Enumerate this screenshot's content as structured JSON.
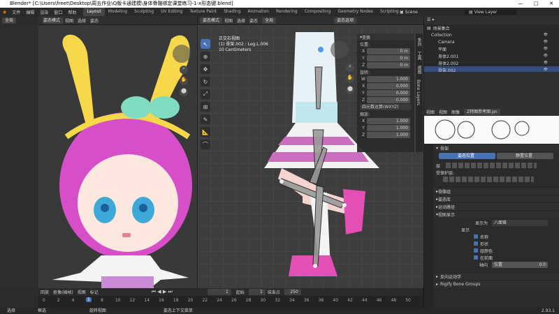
{
  "window": {
    "title": "Blender* [C:\\Users\\freet\\Desktop\\周五作业\\Q版卡通建模\\身体骨骼绑定课堂练习-1-x形态键.blend]",
    "controls": [
      "—",
      "□",
      "✕"
    ]
  },
  "menu": [
    "文件",
    "编辑",
    "渲染",
    "窗口",
    "帮助"
  ],
  "workspaces": [
    "Layout",
    "Modeling",
    "Sculpting",
    "UV Editing",
    "Texture Paint",
    "Shading",
    "Animation",
    "Rendering",
    "Compositing",
    "Geometry Nodes",
    "Scripting"
  ],
  "active_workspace": "Layout",
  "scene": {
    "label": "Scene",
    "view_layer": "View Layer"
  },
  "left_view": {
    "mode": "姿态模式",
    "menus": [
      "视图",
      "选择",
      "姿态"
    ],
    "orient": "全局",
    "overlay": "姿态选项"
  },
  "mid_view": {
    "mode": "姿态模式",
    "menus": [
      "视图",
      "选择",
      "姿态"
    ],
    "orient": "全局",
    "overlay": "姿态选项",
    "info": [
      "正交右视图",
      "(1) 骨架.002 : Leg.L.006",
      "10 Centimeters"
    ]
  },
  "transform_panel": {
    "title": "变换",
    "location_label": "位置:",
    "location": [
      {
        "axis": "X",
        "value": "0 m"
      },
      {
        "axis": "Y",
        "value": "0 m"
      },
      {
        "axis": "Z",
        "value": "0 m"
      }
    ],
    "rotation_label": "旋转:",
    "rotation": [
      {
        "axis": "W",
        "value": "1.000"
      },
      {
        "axis": "X",
        "value": "0.000"
      },
      {
        "axis": "Y",
        "value": "0.000"
      },
      {
        "axis": "Z",
        "value": "0.000"
      }
    ],
    "rotation_mode": "四元数运算(WXYZ)",
    "scale_label": "缩放:",
    "scale": [
      {
        "axis": "X",
        "value": "1.000"
      },
      {
        "axis": "Y",
        "value": "1.000"
      },
      {
        "axis": "Z",
        "value": "1.000"
      }
    ],
    "side_tabs": [
      "条目",
      "工具",
      "视图",
      "Bone Layers"
    ]
  },
  "outliner": {
    "header": "场景集合",
    "items": [
      {
        "name": "Collection",
        "indent": 0
      },
      {
        "name": "Camera",
        "indent": 1
      },
      {
        "name": "平面",
        "indent": 1
      },
      {
        "name": "身体2.001",
        "indent": 1
      },
      {
        "name": "身体2.002",
        "indent": 1
      },
      {
        "name": "骨架.002",
        "indent": 1,
        "selected": true
      }
    ]
  },
  "image_editor": {
    "menus": [
      "视图",
      "视图",
      "图像"
    ],
    "image_name": "Z特图参考图.pn"
  },
  "properties": {
    "section": "骨架",
    "pose_buttons": [
      "姿态位置",
      "静置位置"
    ],
    "bone_layers_label": "层",
    "protected_label": "受保护层:",
    "sections": [
      "骨骼组",
      "姿态库",
      "运动路径",
      "视图显示"
    ],
    "display_as_label": "显示为",
    "display_as": "八面锥",
    "show_label": "显示",
    "show_options": [
      "名称",
      "形状",
      "组颜色",
      "在前面"
    ],
    "axes_label": "轴向",
    "axes_pos": "位置",
    "axes_value": "0.0",
    "more_sections": [
      "反向运动学",
      "Rigify Bone Groups"
    ]
  },
  "timeline": {
    "menus": [
      "回放",
      "抠像(插帧)",
      "视图",
      "标记"
    ],
    "current_frame": "1",
    "start_label": "起始",
    "start": "1",
    "end_label": "结束点",
    "end": "250",
    "ticks": [
      "0",
      "2",
      "4",
      "6",
      "8",
      "10",
      "12",
      "14",
      "16",
      "18",
      "20",
      "22",
      "24",
      "26",
      "28",
      "30",
      "32",
      "34",
      "36",
      "38",
      "40",
      "42",
      "44",
      "46",
      "48",
      "50"
    ]
  },
  "statusbar": {
    "left": "选择",
    "mid1": "框选",
    "mid2": "旋转视图",
    "mid3": "姿态上下文菜单",
    "version": "2.93.1"
  },
  "colors": {
    "accent": "#4772b3",
    "select": "#e8a33a"
  }
}
